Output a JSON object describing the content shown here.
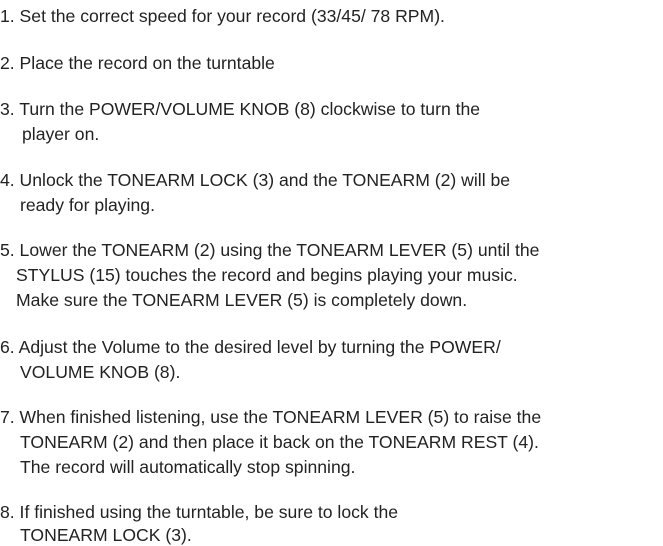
{
  "steps": [
    {
      "lines": [
        "1. Set the correct speed for your record (33/45/ 78 RPM)."
      ]
    },
    {
      "lines": [
        "2. Place the record on the turntable"
      ]
    },
    {
      "lines": [
        "3. Turn the POWER/VOLUME KNOB (8) clockwise to turn the",
        "player on."
      ]
    },
    {
      "lines": [
        "4. Unlock the TONEARM LOCK (3) and the TONEARM (2) will be",
        "ready for playing."
      ]
    },
    {
      "lines": [
        "5. Lower the TONEARM (2) using the TONEARM LEVER (5) until the",
        "STYLUS (15) touches the record and begins playing your music.",
        "Make sure the TONEARM LEVER (5) is completely down."
      ]
    },
    {
      "lines": [
        "6. Adjust the Volume to the desired level by turning the POWER/",
        "VOLUME KNOB (8)."
      ]
    },
    {
      "lines": [
        "7. When finished listening, use the TONEARM LEVER (5) to raise the",
        "TONEARM (2) and then place it back on the TONEARM REST (4).",
        "The record will automatically stop spinning."
      ]
    },
    {
      "lines": [
        "8. If finished using the turntable, be sure to lock the",
        "TONEARM LOCK (3)."
      ]
    }
  ]
}
